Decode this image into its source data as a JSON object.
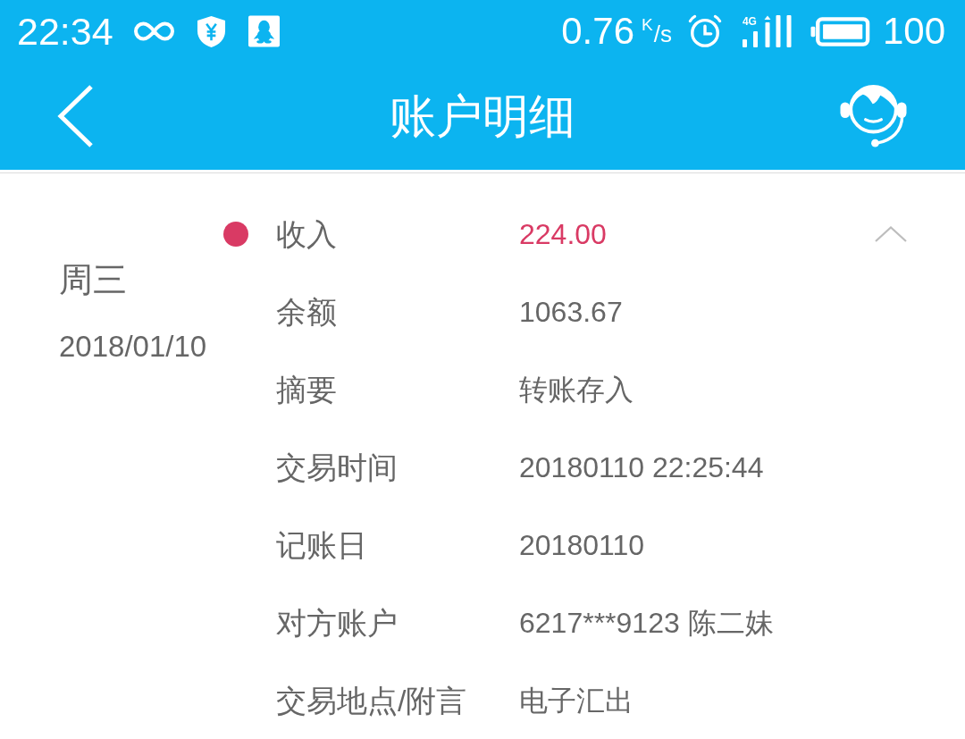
{
  "status_bar": {
    "time": "22:34",
    "network_speed": "0.76",
    "speed_unit": "$^{K}$/s",
    "network_type": "4G",
    "battery": "100"
  },
  "header": {
    "title": "账户明细"
  },
  "record": {
    "weekday": "周三",
    "date": "2018/01/10",
    "color": "#d93a64",
    "expanded": true,
    "fields": [
      {
        "label": "收入",
        "value": "224.00",
        "kind": "amount"
      },
      {
        "label": "余额",
        "value": "1063.67",
        "kind": "text"
      },
      {
        "label": "摘要",
        "value": "转账存入",
        "kind": "text"
      },
      {
        "label": "交易时间",
        "value": "20180110 22:25:44",
        "kind": "text"
      },
      {
        "label": "记账日",
        "value": "20180110",
        "kind": "text"
      },
      {
        "label": "对方账户",
        "value": "6217***9123 陈二妹",
        "kind": "text"
      },
      {
        "label": "交易地点/附言",
        "value": "电子汇出",
        "kind": "text"
      }
    ]
  }
}
